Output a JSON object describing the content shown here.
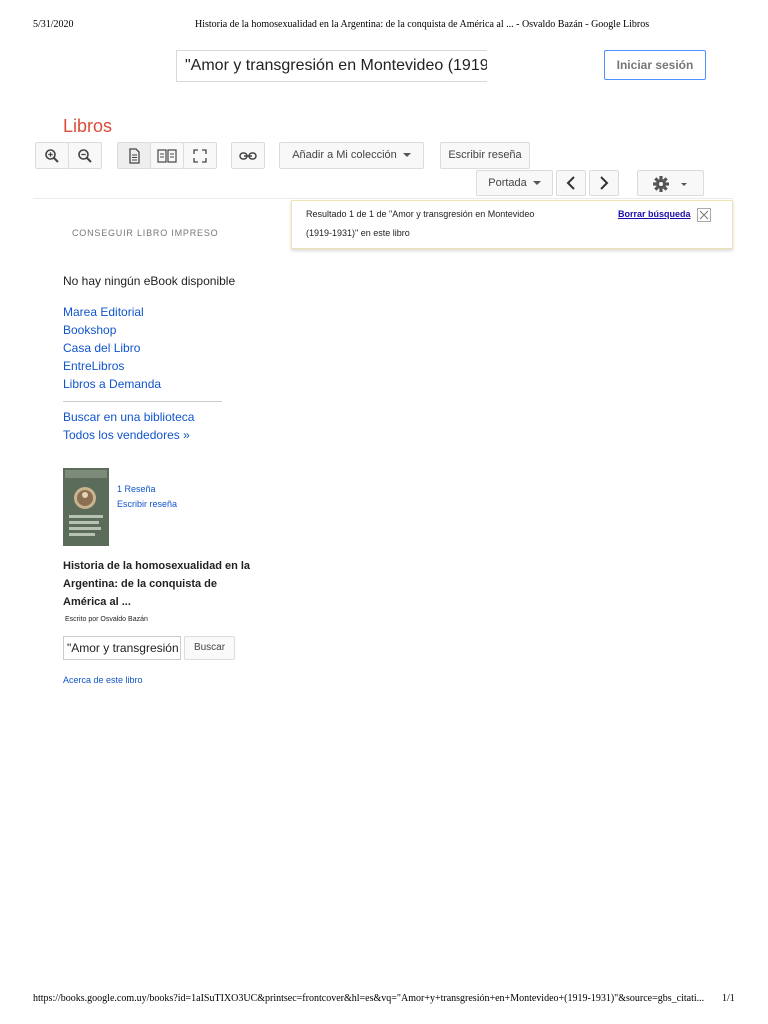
{
  "print": {
    "date": "5/31/2020",
    "title": "Historia de la homosexualidad en la Argentina: de la conquista de América al ... - Osvaldo Bazán - Google Libros",
    "url": "https://books.google.com.uy/books?id=1aISuTIXO3UC&printsec=frontcover&hl=es&vq=\"Amor+y+transgresión+en+Montevideo+(1919-1931)\"&source=gbs_citati...",
    "page": "1/1"
  },
  "header": {
    "search_value": "\"Amor y transgresión en Montevideo (1919-",
    "signin_label": "Iniciar sesión"
  },
  "brand": "Libros",
  "toolbar": {
    "add_collection": "Añadir a Mi colección",
    "write_review": "Escribir reseña",
    "portada": "Portada"
  },
  "result": {
    "line1": "Resultado 1 de 1 de \"Amor y transgresión en Montevideo",
    "line2": "(1919-1931)\" en este libro",
    "clear": "Borrar búsqueda"
  },
  "sidebar": {
    "get_print": "CONSEGUIR LIBRO IMPRESO",
    "no_ebook": "No hay ningún eBook disponible",
    "stores": [
      "Marea Editorial",
      "Bookshop",
      "Casa del Libro",
      "EntreLibros",
      "Libros a Demanda"
    ],
    "library": "Buscar en una biblioteca",
    "all_sellers": "Todos los vendedores »",
    "reviews_count": "1 Reseña",
    "write_review": "Escribir reseña",
    "book_title": "Historia de la homosexualidad en la Argentina: de la conquista de América al ...",
    "author": "Escrito por Osvaldo Bazán",
    "inbook_search_value": "\"Amor y transgresión",
    "inbook_search_btn": "Buscar",
    "about": "Acerca de este libro"
  }
}
